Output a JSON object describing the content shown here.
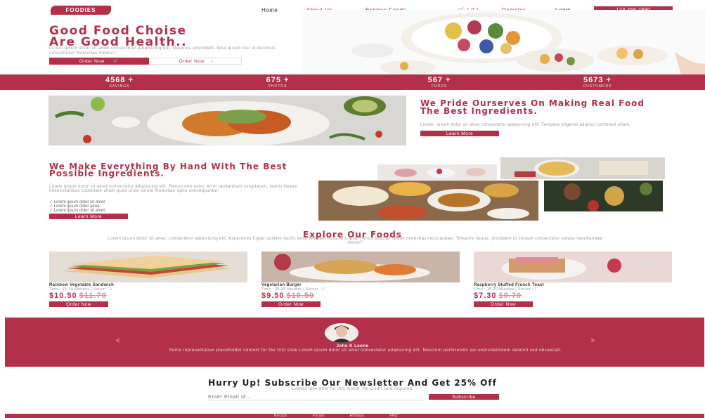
{
  "nav": {
    "logo": "FOODIES",
    "home": "Home",
    "about": "About Us",
    "explore": "Explore Foods",
    "cart": "( 0 )",
    "register": "Register",
    "login": "Login",
    "phone": "123 456 7890"
  },
  "hero": {
    "title_line1": "Good Food Choise",
    "title_line2": "Are Good Health..",
    "subtitle": "Lorem ipsum dolor sit amet consectetur adipisicing elit. Maiores, provident. Ipsa ipsam nisi ut ducimus consectetur molestiae molesti",
    "order_now": "Order Now",
    "order_now_2": "Order Now"
  },
  "stats": [
    {
      "num": "4568 +",
      "label": "SAVINGS"
    },
    {
      "num": "675 +",
      "label": "PHOTOS"
    },
    {
      "num": "567 +",
      "label": "FOODS"
    },
    {
      "num": "5673 +",
      "label": "CUSTOMERS"
    }
  ],
  "pride": {
    "title": "We Pride Ourserves On Making Real Food The Best Ingredients.",
    "text": "Lorem, ipsum dolor sit amet consectetur adipisicing elit. Tempora eligendi adipisci commodi ullam.",
    "button": "Learn More"
  },
  "handmade": {
    "title": "We Make Everything By Hand With The Best Possible Ingredients.",
    "text": "Lorem ipsum dolor sit amet consectetur adipisicing elit. Rerum non enim, error laudantium voluptatem, facilis facere necessitatibus cupiditate ullam quod unde soluta molestiae optio consequuntur!",
    "list": [
      "Lorem ipsum dolor sit amet.",
      "Lorem ipsum dolor amet.",
      "Lorem ipsum dolor sit amet."
    ],
    "button": "Learn More"
  },
  "explore": {
    "title": "Explore Our Foods",
    "text": "Lorem ipsum dolor sit amet, consectetur adipisicing elit. Asperiores fugiat quidem facilis enim aliquam possimus ipsa, minus suscipit rerum molestias recusandae. Tempore neque, provident id veniam consectetur soluta repudiandae rerum?",
    "cards": [
      {
        "name": "Rainbow Vegetable Sandwich",
        "time": "Time : 15-20 Minutes | Server : 1",
        "price": "$10.50",
        "old_price": "$11.70",
        "button": "Order Now"
      },
      {
        "name": "Vegetarian Burger",
        "time": "Time : 30-35 Minutes | Server : 1",
        "price": "$9.50",
        "old_price": "$10.50",
        "button": "Order Now"
      },
      {
        "name": "Raspberry Stuffed French Toast",
        "time": "Time : 15-20 Minutes | Server : 1",
        "price": "$7.30",
        "old_price": "10.70",
        "button": "Order Now"
      }
    ]
  },
  "testimonial": {
    "name": "John K Leone",
    "quote": "Some representative placeholder content for the first slide Lorem ipsum dolor sit amet consectetur adipisicing elit. Nesciunt perferendis qui exercitationem deleniti sed obcaecati.",
    "prev": "<",
    "next": ">"
  },
  "newsletter": {
    "title": "Hurry Up! Subscribe Our Newsletter And Get 25% Off",
    "subtitle": "Limited time offer for this month. No credit card required.",
    "placeholder": "Enter Email Id...",
    "button": "Subscribe"
  },
  "footer": {
    "links": [
      "Recipe",
      "Forum",
      "Affiliate",
      "FAQ"
    ]
  },
  "colors": {
    "brand": "#b3304a"
  }
}
